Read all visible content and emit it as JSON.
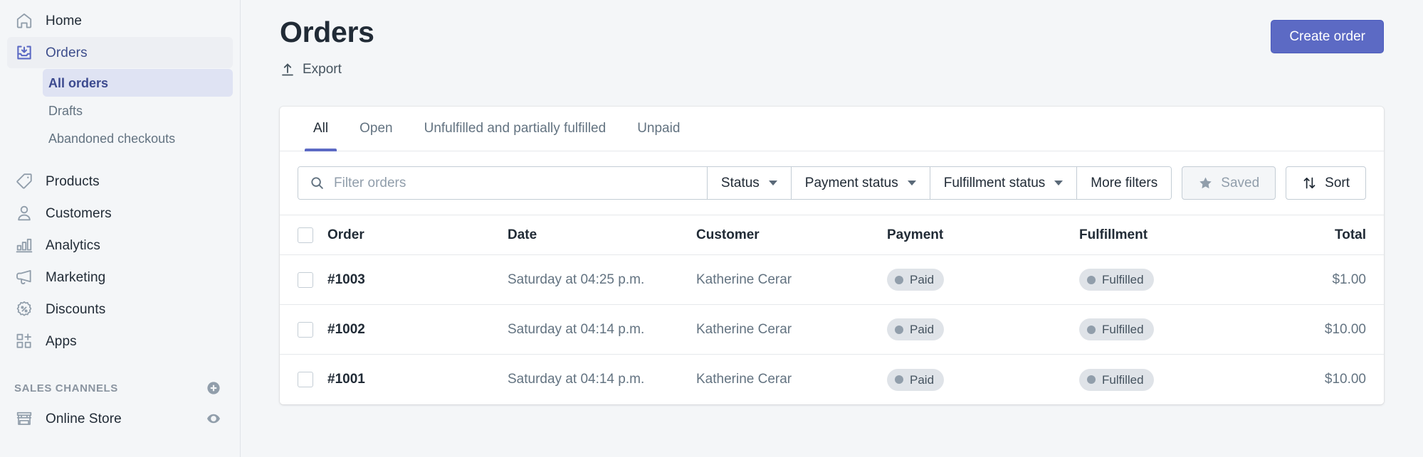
{
  "sidebar": {
    "items": [
      {
        "label": "Home",
        "icon": "home-icon",
        "key": "home",
        "active": false
      },
      {
        "label": "Orders",
        "icon": "orders-inbox-icon",
        "key": "orders",
        "active": true
      },
      {
        "label": "Products",
        "icon": "products-tag-icon",
        "key": "products",
        "active": false
      },
      {
        "label": "Customers",
        "icon": "customers-person-icon",
        "key": "customers",
        "active": false
      },
      {
        "label": "Analytics",
        "icon": "analytics-bars-icon",
        "key": "analytics",
        "active": false
      },
      {
        "label": "Marketing",
        "icon": "marketing-megaphone-icon",
        "key": "marketing",
        "active": false
      },
      {
        "label": "Discounts",
        "icon": "discounts-percent-icon",
        "key": "discounts",
        "active": false
      },
      {
        "label": "Apps",
        "icon": "apps-grid-plus-icon",
        "key": "apps",
        "active": false
      }
    ],
    "sub_items": [
      {
        "label": "All orders",
        "selected": true
      },
      {
        "label": "Drafts",
        "selected": false
      },
      {
        "label": "Abandoned checkouts",
        "selected": false
      }
    ],
    "sales_channels": {
      "title": "SALES CHANNELS",
      "add_icon": "plus-circle-icon",
      "items": [
        {
          "label": "Online Store",
          "icon": "storefront-icon",
          "action_icon": "eye-icon"
        }
      ]
    }
  },
  "header": {
    "title": "Orders",
    "export_label": "Export",
    "export_icon": "export-upload-icon",
    "create_order_label": "Create order"
  },
  "tabs": [
    {
      "label": "All",
      "active": true
    },
    {
      "label": "Open",
      "active": false
    },
    {
      "label": "Unfulfilled and partially fulfilled",
      "active": false
    },
    {
      "label": "Unpaid",
      "active": false
    }
  ],
  "filters": {
    "search_placeholder": "Filter orders",
    "search_value": "",
    "search_icon": "search-icon",
    "dropdowns": [
      {
        "label": "Status"
      },
      {
        "label": "Payment status"
      },
      {
        "label": "Fulfillment status"
      }
    ],
    "more_filters_label": "More filters",
    "saved_label": "Saved",
    "saved_icon": "star-icon",
    "sort_label": "Sort",
    "sort_icon": "sort-arrows-icon"
  },
  "table": {
    "columns": {
      "order": "Order",
      "date": "Date",
      "customer": "Customer",
      "payment": "Payment",
      "fulfillment": "Fulfillment",
      "total": "Total"
    },
    "rows": [
      {
        "order": "#1003",
        "date": "Saturday at 04:25 p.m.",
        "customer": "Katherine Cerar",
        "payment": "Paid",
        "fulfillment": "Fulfilled",
        "total": "$1.00"
      },
      {
        "order": "#1002",
        "date": "Saturday at 04:14 p.m.",
        "customer": "Katherine Cerar",
        "payment": "Paid",
        "fulfillment": "Fulfilled",
        "total": "$10.00"
      },
      {
        "order": "#1001",
        "date": "Saturday at 04:14 p.m.",
        "customer": "Katherine Cerar",
        "payment": "Paid",
        "fulfillment": "Fulfilled",
        "total": "$10.00"
      }
    ]
  },
  "colors": {
    "accent": "#5c6ac4",
    "page_bg": "#f4f6f8",
    "text": "#212b36",
    "muted": "#637381",
    "badge_bg": "#dfe3e8",
    "badge_dot": "#919eab",
    "selected_sub_bg": "#dfe3f3"
  }
}
